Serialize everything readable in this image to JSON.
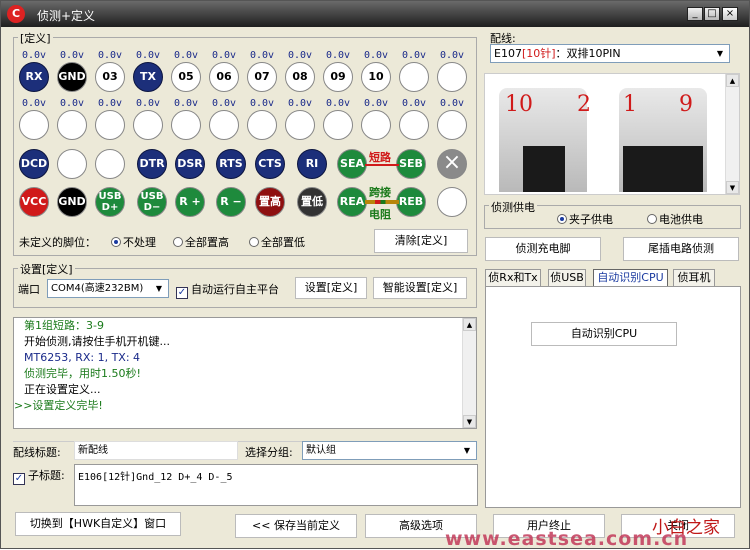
{
  "window": {
    "title": "侦测+定义",
    "logo": "C",
    "buttons": [
      "_",
      "□",
      "×"
    ]
  },
  "define_group": {
    "title": "[定义]",
    "row1_volts": [
      "0.0v",
      "0.0v",
      "0.0v",
      "0.0v",
      "0.0v",
      "0.0v",
      "0.0v",
      "0.0v",
      "0.0v",
      "0.0v",
      "0.0v",
      "0.0v"
    ],
    "row1_pins": [
      "RX",
      "GND",
      "03",
      "TX",
      "05",
      "06",
      "07",
      "08",
      "09",
      "10",
      "",
      ""
    ],
    "row2_volts": [
      "0.0v",
      "0.0v",
      "0.0v",
      "0.0v",
      "0.0v",
      "0.0v",
      "0.0v",
      "0.0v",
      "0.0v",
      "0.0v",
      "0.0v",
      "0.0v"
    ],
    "row3_pins": [
      "DCD",
      "",
      "",
      "DTR",
      "DSR",
      "RTS",
      "CTS",
      "RI",
      "SEA",
      "SEB"
    ],
    "row3_close_icon": "×",
    "row4_pins": [
      "VCC",
      "GND",
      "USB\nD+",
      "USB\nD−",
      "R +",
      "R −",
      "置高",
      "置低",
      "REA",
      "REB"
    ],
    "short_label": "短路",
    "jump_label": "跨接",
    "resistor_label": "电阻",
    "undef_label": "未定义的脚位：",
    "undef_options": [
      "不处理",
      "全部置高",
      "全部置低"
    ],
    "clear_button": "清除[定义]"
  },
  "settings_group": {
    "title": "设置[定义]",
    "port_label": "端口",
    "port_value": "COM4(高速232BM)",
    "auto_label": "自动运行自主平台",
    "set_button": "设置[定义]",
    "smart_button": "智能设置[定义]"
  },
  "log": {
    "lines": [
      "第1组短路：3-9",
      "开始侦测,请按住手机开机键...",
      "MT6253, RX: 1, TX: 4",
      "侦测完毕，用时1.50秒!",
      "正在设置定义...",
      ">>设置定义完毕!"
    ],
    "colors": [
      "#1a7a1a",
      "#000000",
      "#1a2a8a",
      "#1a7a1a",
      "#000000",
      "#1a7a1a"
    ]
  },
  "bottom": {
    "title_label": "配线标题:",
    "title_value": "新配线",
    "group_label": "选择分组:",
    "group_value": "默认组",
    "sub_label": "子标题:",
    "sub_value": "E106[12针]Gnd_12  D+_4  D-_5"
  },
  "footer_buttons": {
    "switch": "切换到【HWK自定义】窗口",
    "save": "<< 保存当前定义",
    "advanced": "高级选项",
    "abort": "用户终止",
    "close": "关闭"
  },
  "right": {
    "wiring_label": "配线:",
    "wiring_value_prefix": "E107",
    "wiring_value_tag": "[10针]",
    "wiring_value_suffix": "：双排10PIN",
    "photo_labels": [
      "10",
      "2",
      "1",
      "9"
    ],
    "power_title": "侦测供电",
    "power_options": [
      "夹子供电",
      "电池供电"
    ],
    "charge_button": "侦测充电脚",
    "tail_button": "尾插电路侦测",
    "tabs": [
      "侦Rx和Tx",
      "侦USB",
      "自动识别CPU",
      "侦耳机"
    ],
    "auto_cpu_button": "自动识别CPU"
  },
  "watermark": {
    "top": "小白之家",
    "bottom": "www.eastsea.com.cn"
  }
}
